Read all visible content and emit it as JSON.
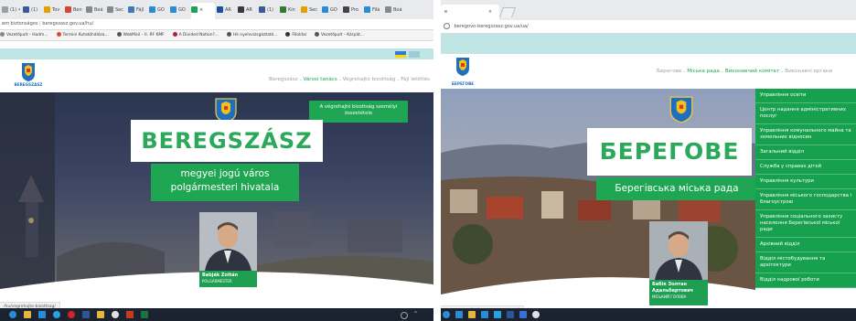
{
  "left": {
    "tabs": [
      {
        "label": "(1) •",
        "icon_color": "#9e9e9e"
      },
      {
        "label": "(1)",
        "icon_color": "#3b5998"
      },
      {
        "label": "Tov",
        "icon_color": "#e2a100"
      },
      {
        "label": "Ben",
        "icon_color": "#d14836"
      },
      {
        "label": "Beá",
        "icon_color": "#888888"
      },
      {
        "label": "Sec",
        "icon_color": "#888888"
      },
      {
        "label": "Fájl",
        "icon_color": "#3d7ab8"
      },
      {
        "label": "GO",
        "icon_color": "#2b8cd6"
      },
      {
        "label": "GO",
        "icon_color": "#2b8cd6"
      },
      {
        "label": "×",
        "icon_color": "#1ea454"
      },
      {
        "label": "AR",
        "icon_color": "#1a4fa0"
      },
      {
        "label": "AR",
        "icon_color": "#3a3a3a"
      },
      {
        "label": "(1)",
        "icon_color": "#3b5998"
      },
      {
        "label": "Kin",
        "icon_color": "#2e7d32"
      },
      {
        "label": "Sec",
        "icon_color": "#e2a100"
      },
      {
        "label": "GO",
        "icon_color": "#2b8cd6"
      },
      {
        "label": "Pro",
        "icon_color": "#444444"
      },
      {
        "label": "Filá",
        "icon_color": "#2b8cd6"
      },
      {
        "label": "Boá",
        "icon_color": "#888888"
      }
    ],
    "url_prefix": "em biztonságos",
    "url": "beregszasz.gov.ua/hu/",
    "bookmarks": [
      {
        "label": "Vezetőpult – Hodm...",
        "color": "#888888"
      },
      {
        "label": "Termini Kutatóhálóza...",
        "color": "#d84a2c"
      },
      {
        "label": "WebMail – II. RF KMF",
        "color": "#555555"
      },
      {
        "label": "A Divided Nation?...",
        "color": "#b0262d"
      },
      {
        "label": "Hk nyelvvizsgáztató...",
        "color": "#555555"
      },
      {
        "label": "Főoldal",
        "color": "#333333"
      },
      {
        "label": "Vezetőpult – Kárpát...",
        "color": "#555555"
      }
    ],
    "lang_flag": "HU",
    "nav": {
      "items": [
        "Beregszász",
        "Városi tanács",
        "Végrehajtó bizottság",
        "Fájl letöltés"
      ],
      "active_index": 1
    },
    "logo_text": "BEREGSZÁSZ",
    "notice": "A végrehajtó bizottság személyi összetétele",
    "city_name": "BEREGSZÁSZ",
    "subtitle_line1": "megyei jogú város",
    "subtitle_line2": "polgármesteri hivatala",
    "mayor_name": "Babják Zoltán",
    "mayor_role": "POLGÁRMESTER",
    "status_url": "/hu/vegrehajto-bizottsag/"
  },
  "right": {
    "tab_title": "e",
    "url": "beregovo-beregszasz.gov.ua/ua/",
    "nav": {
      "items": [
        "Берегове",
        "Міська рада",
        "Виконавчий комітет",
        "Виконавчі органи"
      ],
      "active_indices": [
        1,
        2
      ]
    },
    "logo_text": "БЕРЕГОВЕ",
    "city_name": "БЕРЕГОВЕ",
    "subtitle": "Берегівська міська рада",
    "mayor_name_line1": "Бабік Золтан",
    "mayor_name_line2": "Адальбертович",
    "mayor_role": "МІСЬКИЙ ГОЛОВА",
    "menu": [
      "Управління освіти",
      "Центр надання адміністративних послуг",
      "Управління комунального майна та земельних відносин",
      "Загальний відділ",
      "Служба у справах дітей",
      "Управління культури",
      "Управління міського господарства і благоустрою",
      "Управління соціального захисту населення Берегівської міської ради",
      "Архівний відділ",
      "Відділ містобудування та архітектури",
      "Відділ кадрової роботи"
    ],
    "status_url": "szasz.gov.ua/ua/виконавчо-органи/"
  },
  "colors": {
    "brand_green": "#1fa653",
    "teal_bar": "#bfe6e4",
    "taskbar": "#1c2330"
  }
}
